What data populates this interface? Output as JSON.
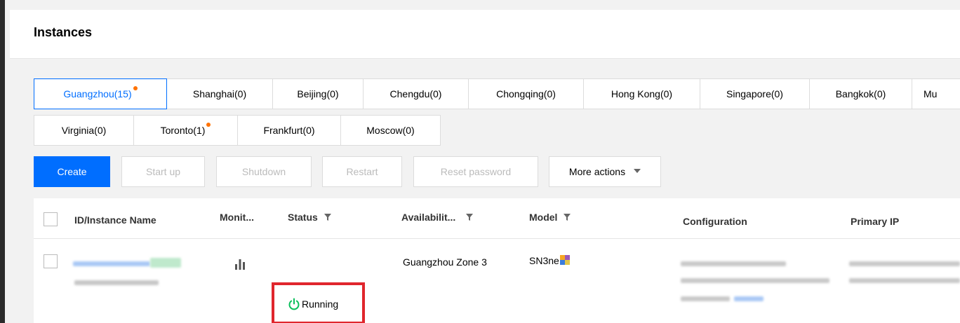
{
  "page": {
    "title": "Instances"
  },
  "regions": {
    "row1": [
      {
        "label": "Guangzhou(15)",
        "dot": true,
        "active": true
      },
      {
        "label": "Shanghai(0)"
      },
      {
        "label": "Beijing(0)"
      },
      {
        "label": "Chengdu(0)"
      },
      {
        "label": "Chongqing(0)"
      },
      {
        "label": "Hong Kong(0)"
      },
      {
        "label": "Singapore(0)"
      },
      {
        "label": "Bangkok(0)"
      },
      {
        "label": "Mu"
      }
    ],
    "row2": [
      {
        "label": "Virginia(0)"
      },
      {
        "label": "Toronto(1)",
        "dot": true
      },
      {
        "label": "Frankfurt(0)"
      },
      {
        "label": "Moscow(0)"
      }
    ]
  },
  "toolbar": {
    "create": "Create",
    "start_up": "Start up",
    "shutdown": "Shutdown",
    "restart": "Restart",
    "reset_password": "Reset password",
    "more_actions": "More actions"
  },
  "table": {
    "columns": {
      "id": "ID/Instance Name",
      "monitoring": "Monit...",
      "status": "Status",
      "availability": "Availabilit...",
      "model": "Model",
      "configuration": "Configuration",
      "primary_ip": "Primary IP"
    },
    "rows": [
      {
        "status": "Running",
        "availability": "Guangzhou Zone 3",
        "model": "SN3ne"
      }
    ]
  },
  "colors": {
    "accent": "#006eff",
    "running": "#0abf5b",
    "highlight": "#e0262d",
    "dot": "#ff7200"
  }
}
